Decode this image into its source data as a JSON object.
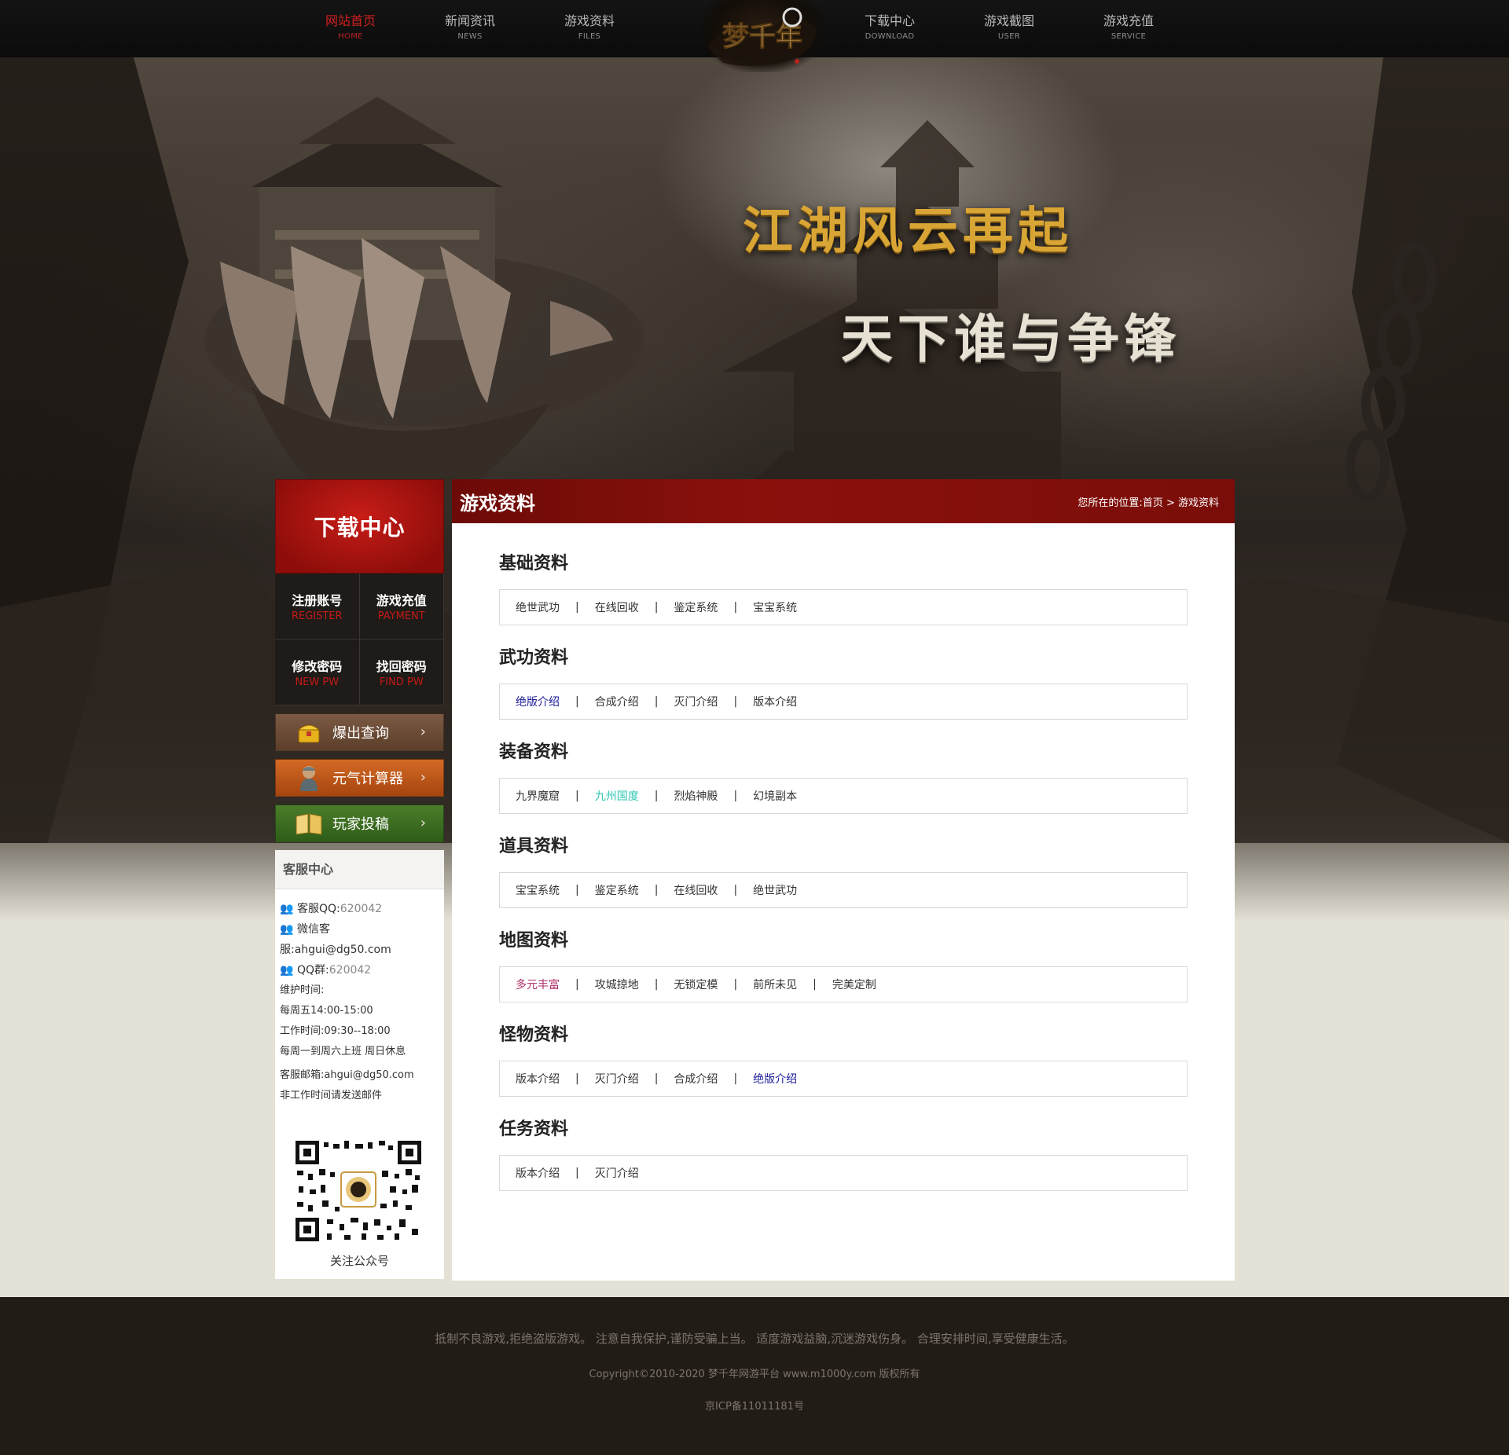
{
  "nav": {
    "items": [
      {
        "cn": "网站首页",
        "en": "HOME",
        "active": true
      },
      {
        "cn": "新闻资讯",
        "en": "NEWS"
      },
      {
        "cn": "游戏资料",
        "en": "FILES"
      },
      {
        "cn": "下载中心",
        "en": "DOWNLOAD"
      },
      {
        "cn": "游戏截图",
        "en": "USER"
      },
      {
        "cn": "游戏充值",
        "en": "SERVICE"
      }
    ],
    "logo_text": "梦千年"
  },
  "banner": {
    "slogan1": "江湖风云再起",
    "slogan2": "天下谁与争锋"
  },
  "sidebar": {
    "download_title": "下载中心",
    "account": [
      {
        "cn": "注册账号",
        "en": "REGISTER"
      },
      {
        "cn": "游戏充值",
        "en": "PAYMENT"
      },
      {
        "cn": "修改密码",
        "en": "NEW PW"
      },
      {
        "cn": "找回密码",
        "en": "FIND PW"
      }
    ],
    "buttons": [
      {
        "label": "爆出查询",
        "icon": "treasure-icon"
      },
      {
        "label": "元气计算器",
        "icon": "warrior-icon"
      },
      {
        "label": "玩家投稿",
        "icon": "book-icon"
      }
    ],
    "service": {
      "title": "客服中心",
      "qq_label": "客服QQ:",
      "qq_value": "620042",
      "wechat_label": "微信客",
      "wechat_value": "服:ahgui@dg50.com",
      "group_label": "QQ群:",
      "group_value": "620042",
      "maint_label": "维护时间:",
      "maint_time": "每周五14:00-15:00",
      "work_time": "工作时间:09:30--18:00",
      "work_days": "每周一到周六上班 周日休息",
      "email": "客服邮箱:ahgui@dg50.com",
      "email_note": "非工作时间请发送邮件",
      "qr_caption": "关注公众号"
    }
  },
  "main": {
    "title": "游戏资料",
    "breadcrumb_prefix": "您所在的位置:",
    "breadcrumb_home": "首页",
    "breadcrumb_sep": ">",
    "breadcrumb_current": "游戏资料",
    "sections": [
      {
        "title": "基础资料",
        "links": [
          {
            "text": "绝世武功",
            "color": "#333333"
          },
          {
            "text": "在线回收",
            "color": "#333333"
          },
          {
            "text": "鉴定系统",
            "color": "#333333"
          },
          {
            "text": "宝宝系统",
            "color": "#333333"
          }
        ]
      },
      {
        "title": "武功资料",
        "links": [
          {
            "text": "绝版介绍",
            "color": "#1a1a9a"
          },
          {
            "text": "合成介绍",
            "color": "#333333"
          },
          {
            "text": "灭门介绍",
            "color": "#333333"
          },
          {
            "text": "版本介绍",
            "color": "#333333"
          }
        ]
      },
      {
        "title": "装备资料",
        "links": [
          {
            "text": "九界魔窟",
            "color": "#333333"
          },
          {
            "text": "九州国度",
            "color": "#2fc7b3"
          },
          {
            "text": "烈焰神殿",
            "color": "#333333"
          },
          {
            "text": "幻境副本",
            "color": "#333333"
          }
        ]
      },
      {
        "title": "道具资料",
        "links": [
          {
            "text": "宝宝系统",
            "color": "#333333"
          },
          {
            "text": "鉴定系统",
            "color": "#333333"
          },
          {
            "text": "在线回收",
            "color": "#333333"
          },
          {
            "text": "绝世武功",
            "color": "#333333"
          }
        ]
      },
      {
        "title": "地图资料",
        "links": [
          {
            "text": "多元丰富",
            "color": "#b0306a"
          },
          {
            "text": "攻城掠地",
            "color": "#333333"
          },
          {
            "text": "无锁定模",
            "color": "#333333"
          },
          {
            "text": "前所未见",
            "color": "#333333"
          },
          {
            "text": "完美定制",
            "color": "#333333"
          }
        ]
      },
      {
        "title": "怪物资料",
        "links": [
          {
            "text": "版本介绍",
            "color": "#333333"
          },
          {
            "text": "灭门介绍",
            "color": "#333333"
          },
          {
            "text": "合成介绍",
            "color": "#333333"
          },
          {
            "text": "绝版介绍",
            "color": "#1a1a9a"
          }
        ]
      },
      {
        "title": "任务资料",
        "links": [
          {
            "text": "版本介绍",
            "color": "#333333"
          },
          {
            "text": "灭门介绍",
            "color": "#333333"
          }
        ]
      }
    ]
  },
  "footer": {
    "line1": "抵制不良游戏,拒绝盗版游戏。 注意自我保护,谨防受骗上当。 适度游戏益脑,沉迷游戏伤身。 合理安排时间,享受健康生活。",
    "line2": "Copyright©2010-2020 梦千年网游平台 www.m1000y.com 版权所有",
    "line3": "京ICP备11011181号"
  },
  "colors": {
    "accent_red": "#8b110d",
    "nav_active": "#d1201f",
    "footer_bg": "#221c17"
  }
}
